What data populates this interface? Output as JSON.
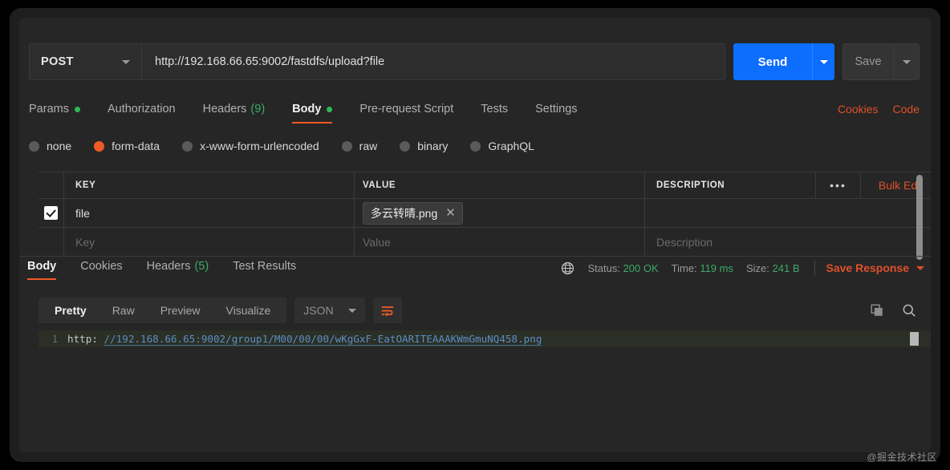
{
  "request": {
    "method": "POST",
    "method_caret_icon": "chevron-down-icon",
    "url": "http://192.168.66.65:9002/fastdfs/upload?file",
    "send_label": "Send",
    "send_caret_icon": "chevron-down-icon",
    "save_label": "Save",
    "save_caret_icon": "chevron-down-icon",
    "tabs": [
      {
        "label": "Params",
        "dot": true,
        "active": false
      },
      {
        "label": "Authorization",
        "dot": false,
        "active": false
      },
      {
        "label": "Headers",
        "count": "(9)",
        "active": false
      },
      {
        "label": "Body",
        "dot": true,
        "active": true
      },
      {
        "label": "Pre-request Script",
        "active": false
      },
      {
        "label": "Tests",
        "active": false
      },
      {
        "label": "Settings",
        "active": false
      }
    ],
    "right_links": [
      {
        "label": "Cookies"
      },
      {
        "label": "Code"
      }
    ],
    "body_types": [
      {
        "label": "none",
        "selected": false
      },
      {
        "label": "form-data",
        "selected": true
      },
      {
        "label": "x-www-form-urlencoded",
        "selected": false
      },
      {
        "label": "raw",
        "selected": false
      },
      {
        "label": "binary",
        "selected": false
      },
      {
        "label": "GraphQL",
        "selected": false
      }
    ],
    "table": {
      "headers": {
        "key": "KEY",
        "value": "VALUE",
        "description": "DESCRIPTION",
        "more_icon": "ellipsis-icon",
        "bulk_edit": "Bulk Edit"
      },
      "rows": [
        {
          "checked": true,
          "key": "file",
          "value_chip": "多云转晴.png",
          "value_chip_remove_icon": "close-icon",
          "description": ""
        }
      ],
      "placeholder_row": {
        "key": "Key",
        "value": "Value",
        "description": "Description"
      }
    }
  },
  "response": {
    "tabs": [
      {
        "label": "Body",
        "active": true
      },
      {
        "label": "Cookies",
        "active": false
      },
      {
        "label": "Headers",
        "count": "(5)",
        "active": false
      },
      {
        "label": "Test Results",
        "active": false
      }
    ],
    "globe_icon": "globe-icon",
    "status_label": "Status:",
    "status_value": "200 OK",
    "time_label": "Time:",
    "time_value": "119 ms",
    "size_label": "Size:",
    "size_value": "241 B",
    "save_response": "Save Response",
    "save_response_caret_icon": "chevron-down-icon",
    "view_modes": [
      {
        "label": "Pretty",
        "active": true
      },
      {
        "label": "Raw",
        "active": false
      },
      {
        "label": "Preview",
        "active": false
      },
      {
        "label": "Visualize",
        "active": false
      }
    ],
    "format": "JSON",
    "format_caret_icon": "chevron-down-icon",
    "wrap_icon": "word-wrap-icon",
    "copy_icon": "copy-icon",
    "search_icon": "search-icon",
    "body": {
      "line_number": "1",
      "prefix": "http: ",
      "url": "//192.168.66.65:9002/group1/M00/00/00/wKgGxF-EatOARITEAAAKWmGmuNQ458.png"
    }
  },
  "watermark": "@掘金技术社区",
  "colors": {
    "accent_orange": "#ef5b25",
    "link_orange": "#e0502a",
    "send_blue": "#0d6efd",
    "status_green": "#3ea968",
    "code_blue": "#5b8ec4"
  }
}
